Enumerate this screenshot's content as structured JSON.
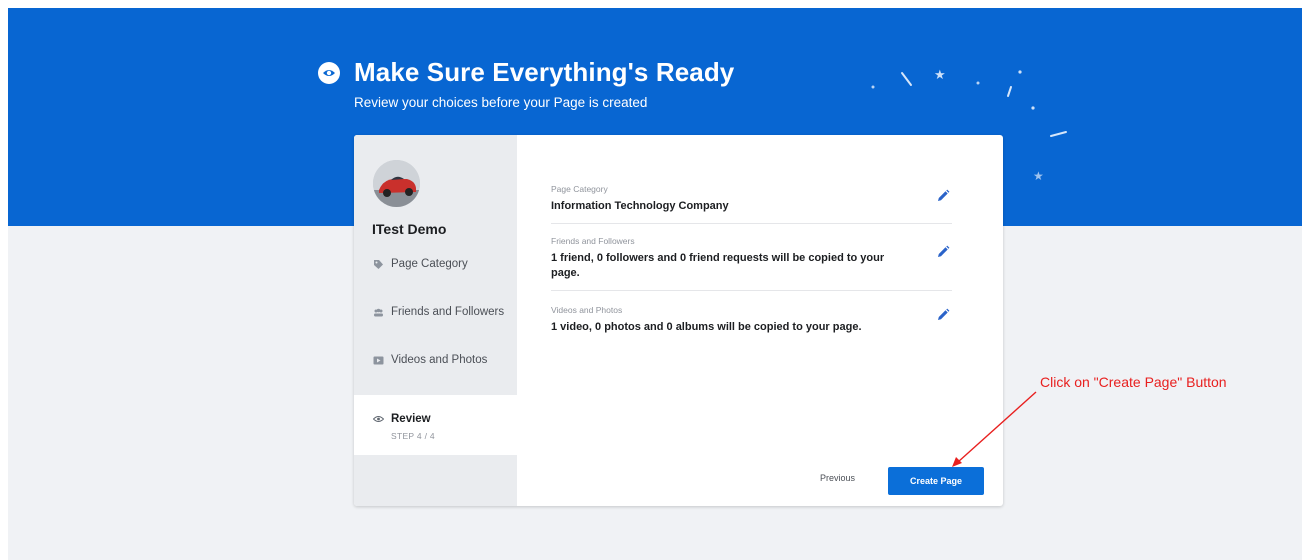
{
  "header": {
    "title": "Make Sure Everything's Ready",
    "subtitle": "Review your choices before your Page is created"
  },
  "sidebar": {
    "page_name": "ITest Demo",
    "items": [
      {
        "label": "Page Category",
        "icon": "tag-icon"
      },
      {
        "label": "Friends and Followers",
        "icon": "people-icon"
      },
      {
        "label": "Videos and Photos",
        "icon": "video-icon"
      },
      {
        "label": "Review",
        "icon": "eye-icon",
        "step": "STEP 4 / 4"
      }
    ]
  },
  "review": {
    "rows": [
      {
        "label": "Page Category",
        "value": "Information Technology Company"
      },
      {
        "label": "Friends and Followers",
        "value": "1 friend, 0 followers and 0 friend requests will be copied to your page."
      },
      {
        "label": "Videos and Photos",
        "value": "1 video, 0 photos and 0 albums will be copied to your page."
      }
    ]
  },
  "actions": {
    "previous_label": "Previous",
    "create_label": "Create Page"
  },
  "annotation": {
    "text": "Click on \"Create Page\" Button",
    "color": "#e8201f"
  },
  "colors": {
    "brand_blue": "#0866d2",
    "button_blue": "#0b6fd9"
  }
}
